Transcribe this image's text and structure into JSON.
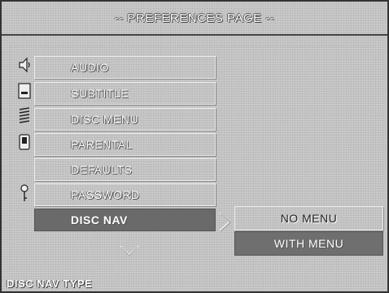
{
  "header": {
    "title": "-- PREFERENCES PAGE --"
  },
  "menu": {
    "items": [
      {
        "label": "AUDIO",
        "icon": "speaker-icon"
      },
      {
        "label": "SUBTITLE",
        "icon": "subtitle-icon"
      },
      {
        "label": "DISC MENU",
        "icon": "disc-menu-icon"
      },
      {
        "label": "PARENTAL",
        "icon": "parental-icon"
      },
      {
        "label": "DEFAULTS",
        "icon": ""
      },
      {
        "label": "PASSWORD",
        "icon": "key-icon"
      },
      {
        "label": "DISC NAV",
        "icon": "",
        "selected": true
      }
    ]
  },
  "submenu": {
    "options": [
      {
        "label": "NO MENU",
        "active": false
      },
      {
        "label": "WITH MENU",
        "active": true
      }
    ]
  },
  "status": {
    "text": "DISC NAV TYPE"
  },
  "colors": {
    "selected_bg": "#6a6a6a",
    "background": "#c9c9c9",
    "text": "#ffffff"
  }
}
